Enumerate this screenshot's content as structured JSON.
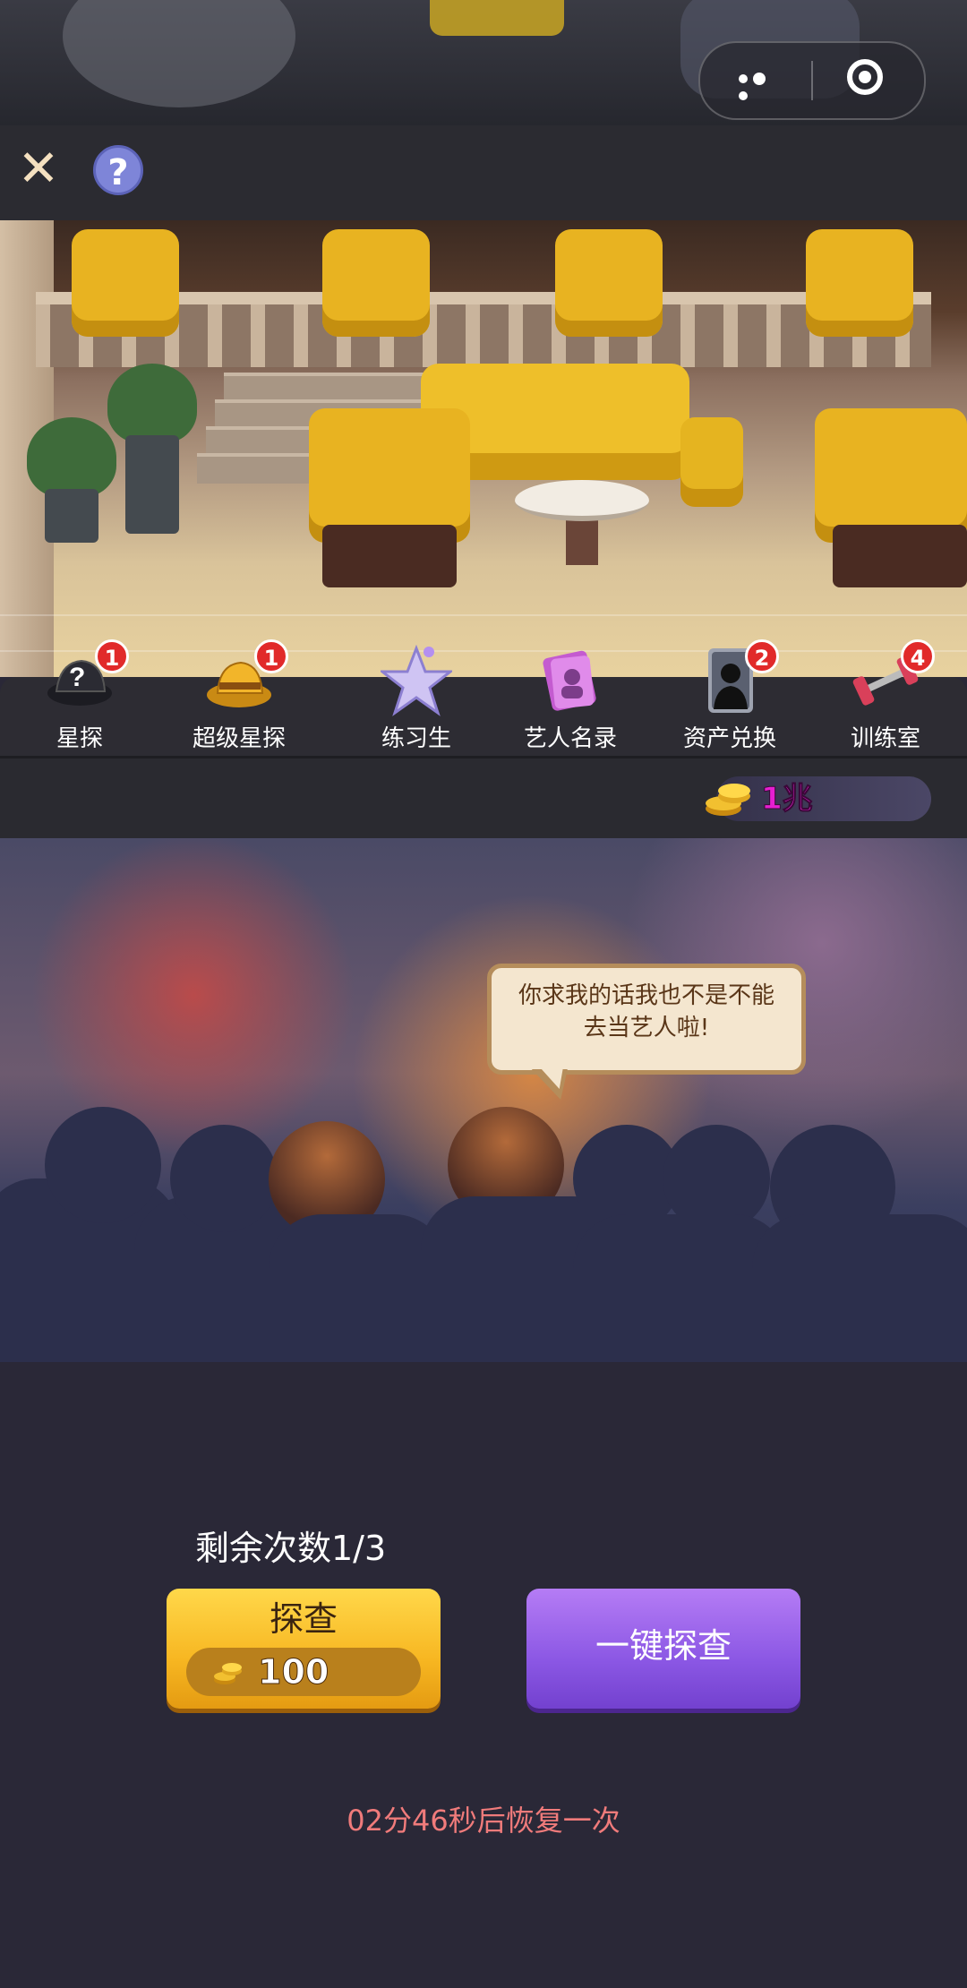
{
  "header": {
    "close_label": "✕",
    "help_label": "?"
  },
  "speech": {
    "line1": "你求我的话我也不是不能",
    "line2": "去当艺人啦!"
  },
  "nav": {
    "items": [
      {
        "label": "星探",
        "badge": "1",
        "icon": "question-hat-icon"
      },
      {
        "label": "超级星探",
        "badge": "1",
        "icon": "gold-hat-icon"
      },
      {
        "label": "练习生",
        "badge": "",
        "icon": "star-icon"
      },
      {
        "label": "艺人名录",
        "badge": "",
        "icon": "roster-book-icon"
      },
      {
        "label": "资产兑换",
        "badge": "2",
        "icon": "silhouette-card-icon"
      },
      {
        "label": "训练室",
        "badge": "4",
        "icon": "dumbbell-icon"
      }
    ]
  },
  "currency": {
    "value": "1兆",
    "icon": "gold-coin-stack-icon"
  },
  "probe": {
    "remaining": "剩余次数1/3",
    "button_label": "探查",
    "cost": "100",
    "oneclick_label": "一键探查",
    "recover_text": "02分46秒后恢复一次"
  },
  "colors": {
    "badge_red": "#e12a2a",
    "probe_yellow": "#f7b621",
    "oneclick_purple": "#8b57e4",
    "recover_text": "#f07b7b",
    "currency_text": "#e61fd0"
  }
}
